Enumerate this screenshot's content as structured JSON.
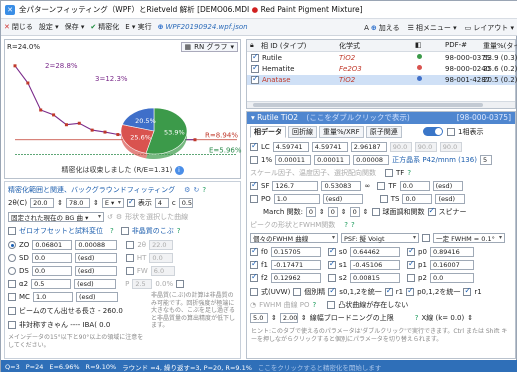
{
  "window": {
    "title_prefix": "全パターンフィッティング（WPF）とRietveld 解析 [DEMO06.MDI",
    "title_dot": "●",
    "title_suffix": "Red Paint Pigment Mixture]"
  },
  "toolbar": {
    "close": "閉じる",
    "settings": "設定 ▾",
    "save": "保存 ▾",
    "refine": "精密化",
    "execute": "E ▾ 実行",
    "file": "WPF20190924.wpf.json",
    "add": "加える",
    "phase_menu": "相メニュー ▾",
    "layout": "レイアウト ▾",
    "add_icon_text": "A"
  },
  "chart": {
    "rwp_label": "R=24.0%",
    "rwp_button": "RN グラフ",
    "annotations": [
      "2=28.8%",
      "3=12.3%",
      "R=8.94%",
      "E=5.96%"
    ],
    "pie_labels": [
      "53.9%",
      "25.6%",
      "20.5%"
    ],
    "footer": "精密化は収束しました (R/E=1.31)",
    "chart_data": {
      "type": "line",
      "series": [
        {
          "values": [
            24.0,
            20.5,
            15.0,
            14.0,
            12.0,
            12.3,
            10.9,
            10.5,
            10.0,
            9.6,
            9.4,
            9.2,
            9.05,
            8.96,
            8.94
          ]
        }
      ],
      "reference_lines": {
        "R": 8.94,
        "E": 5.96
      },
      "pie": {
        "values": [
          53.9,
          25.6,
          20.5
        ],
        "colors": [
          "#3c9a4a",
          "#d9534f",
          "#3f6fc9"
        ]
      }
    }
  },
  "left": {
    "section1": "精密化範囲と関連、バックグラウンドフィッティング",
    "two_theta_label": "2θ(C)",
    "two_theta_from": "20.0",
    "two_theta_to": "78.0",
    "e_label": "E ▾",
    "show_label": "表示",
    "step_label": "4",
    "c_label": "c",
    "c_value": "0.5",
    "bg_mode": "固定された現在の BG 曲 ▾",
    "bg_extra": "形状を選択した曲線",
    "section2": "ゼロオフセットと試料変位",
    "section3": "非晶質のこぶ",
    "zo_label": "ZO",
    "zo_value": "0.06801",
    "zo_err": "0.00088",
    "sd_label": "SD",
    "sd_value": "0.0",
    "sd_err": "(esd)",
    "ds_label": "DS",
    "ds_value": "0.0",
    "ds_err": "(esd)",
    "a2_label": "α2",
    "a2_value": "0.5",
    "a2_err": "(esd)",
    "mc_label": "MC",
    "mc_value": "1.0",
    "mc_err": "(esd)",
    "amor_2theta": "22.0",
    "amor_ht": "0.0",
    "amor_fw": "6.0",
    "amor_p": "2.5",
    "amor_pct": "0.0%",
    "amor_note": "非晶質(こぶ)の計算は非晶質のみ可能です。回折強度が極端に大きなもの、こぶを足し過ぎると非晶質量の算出精度が低下します。",
    "beam_label": "ビームのてん出せる長さ - 260.0",
    "asym_label": "非対称すきゃん ---- IBA( 0.0",
    "bottom_note": "メインデータの15°以下と90°以上の領域に注意をしてください。"
  },
  "phases": {
    "headers": [
      "相 ID (タイプ)",
      "化学式",
      "PDF-#",
      "重量%(タイプ)"
    ],
    "rows": [
      {
        "name": "Rutile",
        "formula": "TiO2",
        "pdf": "98-000-0375",
        "wt": "53.9 (0.3)",
        "color": "#3c9a4a"
      },
      {
        "name": "Hematite",
        "formula": "Fe2O3",
        "pdf": "98-000-0240",
        "wt": "25.6 (0.2)",
        "color": "#d9534f"
      },
      {
        "name": "Anatase",
        "formula": "TiO2",
        "pdf": "98-001-4287",
        "wt": "20.5 (0.2)",
        "color": "#3f6fc9"
      }
    ]
  },
  "phase_detail": {
    "title": "Rutile TiO2",
    "title_hint": "(ここをダブルクリックで表示)",
    "code": "[98-000-0375]",
    "tabs": [
      "相データ",
      "回折線",
      "重量%/XRF",
      "原子関連"
    ],
    "one_theta": "1相表示",
    "lc_label": "LC",
    "lc_values": [
      "4.59741",
      "4.59741",
      "2.96187",
      "90.0",
      "90.0",
      "90.0"
    ],
    "err_label": "1%",
    "err_values": [
      "0.00011",
      "0.00011",
      "0.00008"
    ],
    "space_group": "正方晶系 P42/mnm (136)",
    "sg_num": "5",
    "section_scale": "スケール因子、温度因子、選択配向関数",
    "sf_label": "SF",
    "sf_value": "126.7",
    "sf_err": "0.53083",
    "tf_label": "TF",
    "tf_value": "0.0",
    "tf_err": "(esd)",
    "po_label": "PO",
    "po_value": "1.0",
    "po_err": "(esd)",
    "ts_label": "TS",
    "ts_value": "0.0",
    "ts_err": "(esd)",
    "march_label": "March 関数:",
    "march_vals": [
      "0",
      "0",
      "0"
    ],
    "spherical_label": "球面調和関数",
    "splitter": "スピナー",
    "section_fwhm": "ピークの形状とFWHM関数",
    "fwhm_mode": "個々のFWHM 曲線",
    "psf_mode": "PSF: 擬 Voigt",
    "fwhm_const": "一定 FWHM = 0.1°",
    "f0_label": "f0",
    "f0_value": "0.15705",
    "s0_label": "s0",
    "s0_value": "0.64462",
    "p0_label": "p0",
    "p0_value": "0.89416",
    "f1_label": "f1",
    "f1_value": "-0.17471",
    "s1_label": "s1",
    "s1_value": "-0.45106",
    "p1_label": "p1",
    "p1_value": "0.16007",
    "f2_label": "f2",
    "f2_value": "0.12962",
    "s2_label": "s2",
    "s2_value": "0.00815",
    "p2_label": "p2",
    "p2_value": "0.0",
    "uvw_label": "式(UVW)",
    "indiv_label": "個別精",
    "s0s_label": "s0,1,2を統一",
    "r1_label": "r1",
    "p012_label": "p0,1,2を統一",
    "r1b_label": "r1",
    "shape_label": "凸状曲線が存在しない",
    "xs_label": "X線 (k= 0.0)",
    "range_from": "5.0",
    "range_to": "2.00",
    "range_label": "線幅ブロードニングの上限",
    "hint": "ヒント:このタブで使えるのパラメータは'ダブルクリック'で実行できます。Ctrl または Shift キーを押しながらクリックすると個別にパラメータを切り替えられます。"
  },
  "status": {
    "q": "Q=3",
    "p": "P=24",
    "e": "E=6.96%",
    "r": "R=9.10%",
    "rounds": "ラウンド =4, 繰り返す=3, P=20, R=9.1%",
    "hint": "ここをクリックすると精密化を開始します"
  },
  "colors": {
    "accent": "#2f6fb8",
    "curve": "#7a2a8a",
    "reference": "#c0392b",
    "phase_title": "#4f86cf"
  }
}
